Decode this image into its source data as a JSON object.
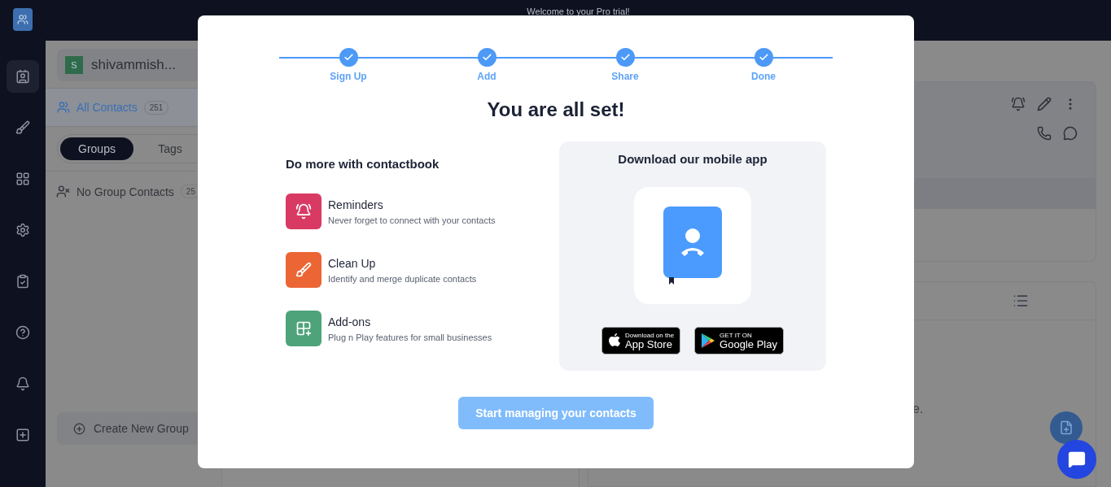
{
  "top_banner": {
    "text": "Welcome to your Pro trial!"
  },
  "nav": {
    "items": [
      {
        "selected": true
      },
      {
        "selected": false
      },
      {
        "selected": false
      },
      {
        "selected": false
      },
      {
        "selected": false
      },
      {
        "selected": false
      },
      {
        "selected": false
      },
      {
        "selected": false
      }
    ]
  },
  "workspace": {
    "initial": "S",
    "name": "shivammish..."
  },
  "all_contacts": {
    "label": "All Contacts",
    "count": "251"
  },
  "segments": [
    {
      "label": "Groups",
      "selected": true
    },
    {
      "label": "Tags",
      "selected": false
    }
  ],
  "groups": [
    {
      "label": "No Group Contacts",
      "count": "25"
    }
  ],
  "create_group_button": {
    "label": "Create New Group"
  },
  "detail_panel": {
    "text_fragment": "e."
  },
  "modal": {
    "steps": [
      {
        "label": "Sign Up",
        "done": true
      },
      {
        "label": "Add",
        "done": true
      },
      {
        "label": "Share",
        "done": true
      },
      {
        "label": "Done",
        "done": true
      }
    ],
    "title": "You are all set!",
    "features_heading": "Do more with contactbook",
    "features": [
      {
        "kind": "reminders",
        "title": "Reminders",
        "description": "Never forget to connect with your contacts",
        "color": "#d93a63"
      },
      {
        "kind": "cleanup",
        "title": "Clean Up",
        "description": "Identify and merge duplicate contacts",
        "color": "#ec6534"
      },
      {
        "kind": "addons",
        "title": "Add-ons",
        "description": "Plug n Play features for small businesses",
        "color": "#4ea37b"
      }
    ],
    "download": {
      "title": "Download our mobile app",
      "stores": [
        {
          "kind": "apple",
          "small": "Download on the",
          "big": "App Store"
        },
        {
          "kind": "google",
          "small": "GET IT ON",
          "big": "Google Play"
        }
      ]
    },
    "cta": "Start managing your contacts"
  }
}
